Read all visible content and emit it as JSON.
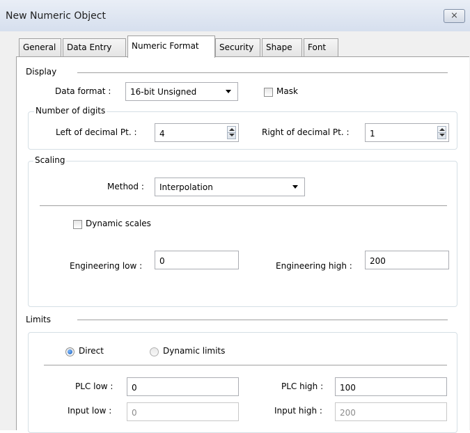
{
  "window": {
    "title": "New Numeric Object",
    "close_glyph": "⨯"
  },
  "tabs": [
    {
      "label": "General"
    },
    {
      "label": "Data Entry"
    },
    {
      "label": "Numeric Format"
    },
    {
      "label": "Security"
    },
    {
      "label": "Shape"
    },
    {
      "label": "Font"
    }
  ],
  "active_tab": "Numeric Format",
  "display": {
    "header": "Display",
    "data_format_label": "Data format :",
    "data_format_value": "16-bit Unsigned",
    "mask_label": "Mask",
    "mask_checked": false
  },
  "digits": {
    "header": "Number of digits",
    "left_label": "Left of decimal Pt. :",
    "left_value": "4",
    "right_label": "Right of decimal Pt. :",
    "right_value": "1"
  },
  "scaling": {
    "header": "Scaling",
    "method_label": "Method :",
    "method_value": "Interpolation",
    "dynamic_scales_label": "Dynamic scales",
    "dynamic_scales_checked": false,
    "eng_low_label": "Engineering low :",
    "eng_low_value": "0",
    "eng_high_label": "Engineering high :",
    "eng_high_value": "200"
  },
  "limits": {
    "header": "Limits",
    "direct_label": "Direct",
    "direct_selected": true,
    "dynamic_limits_label": "Dynamic limits",
    "plc_low_label": "PLC low :",
    "plc_low_value": "0",
    "plc_high_label": "PLC high :",
    "plc_high_value": "100",
    "input_low_label": "Input low :",
    "input_low_value": "0",
    "input_high_label": "Input high :",
    "input_high_value": "200"
  }
}
